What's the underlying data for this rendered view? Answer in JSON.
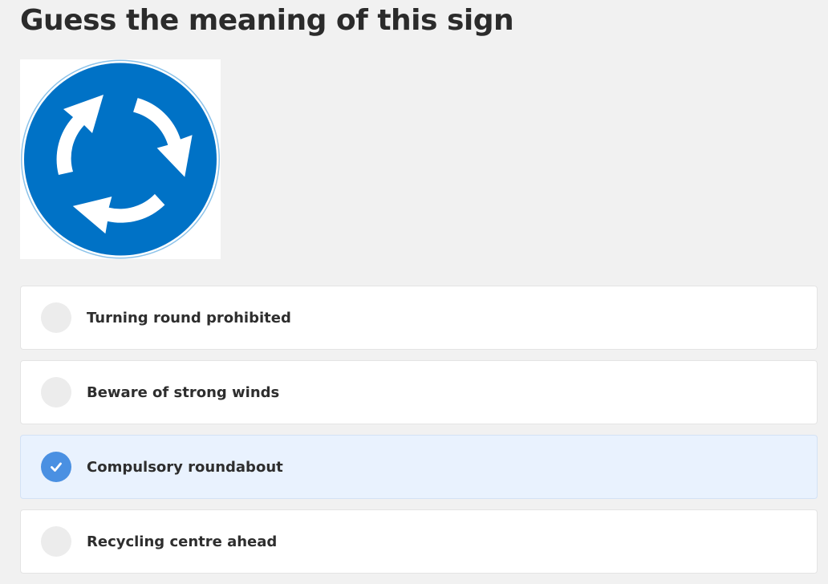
{
  "question": {
    "title": "Guess the meaning of this sign"
  },
  "sign_image": {
    "icon": "compulsory-roundabout-sign",
    "color": "#0072c6"
  },
  "options": [
    {
      "label": "Turning round prohibited",
      "selected": false
    },
    {
      "label": "Beware of strong winds",
      "selected": false
    },
    {
      "label": "Compulsory roundabout",
      "selected": true
    },
    {
      "label": "Recycling centre ahead",
      "selected": false
    }
  ],
  "colors": {
    "accent": "#4a90e2",
    "selected_background": "#e9f2fe",
    "page_background": "#f1f1f1"
  }
}
